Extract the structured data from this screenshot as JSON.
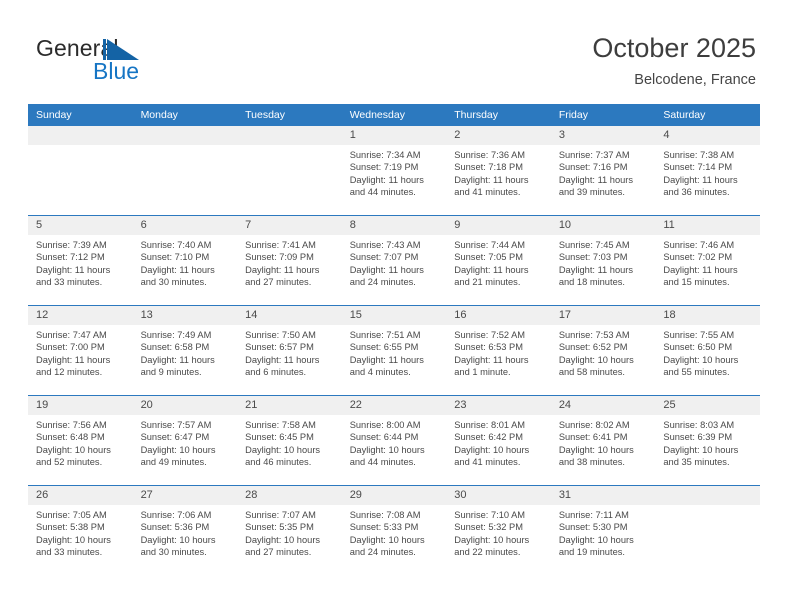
{
  "brand": {
    "name_top": "General",
    "name_bottom": "Blue",
    "accent_color": "#1675c4"
  },
  "header": {
    "title": "October 2025",
    "subtitle": "Belcodene, France"
  },
  "theme": {
    "header_row_bg": "#2c79bf",
    "day_number_bg": "#f0f0f0",
    "text_color": "#494949"
  },
  "weekdays": [
    "Sunday",
    "Monday",
    "Tuesday",
    "Wednesday",
    "Thursday",
    "Friday",
    "Saturday"
  ],
  "weeks": [
    [
      {
        "day": "",
        "sunrise": "",
        "sunset": "",
        "daylight_line1": "",
        "daylight_line2": ""
      },
      {
        "day": "",
        "sunrise": "",
        "sunset": "",
        "daylight_line1": "",
        "daylight_line2": ""
      },
      {
        "day": "",
        "sunrise": "",
        "sunset": "",
        "daylight_line1": "",
        "daylight_line2": ""
      },
      {
        "day": "1",
        "sunrise": "Sunrise: 7:34 AM",
        "sunset": "Sunset: 7:19 PM",
        "daylight_line1": "Daylight: 11 hours",
        "daylight_line2": "and 44 minutes."
      },
      {
        "day": "2",
        "sunrise": "Sunrise: 7:36 AM",
        "sunset": "Sunset: 7:18 PM",
        "daylight_line1": "Daylight: 11 hours",
        "daylight_line2": "and 41 minutes."
      },
      {
        "day": "3",
        "sunrise": "Sunrise: 7:37 AM",
        "sunset": "Sunset: 7:16 PM",
        "daylight_line1": "Daylight: 11 hours",
        "daylight_line2": "and 39 minutes."
      },
      {
        "day": "4",
        "sunrise": "Sunrise: 7:38 AM",
        "sunset": "Sunset: 7:14 PM",
        "daylight_line1": "Daylight: 11 hours",
        "daylight_line2": "and 36 minutes."
      }
    ],
    [
      {
        "day": "5",
        "sunrise": "Sunrise: 7:39 AM",
        "sunset": "Sunset: 7:12 PM",
        "daylight_line1": "Daylight: 11 hours",
        "daylight_line2": "and 33 minutes."
      },
      {
        "day": "6",
        "sunrise": "Sunrise: 7:40 AM",
        "sunset": "Sunset: 7:10 PM",
        "daylight_line1": "Daylight: 11 hours",
        "daylight_line2": "and 30 minutes."
      },
      {
        "day": "7",
        "sunrise": "Sunrise: 7:41 AM",
        "sunset": "Sunset: 7:09 PM",
        "daylight_line1": "Daylight: 11 hours",
        "daylight_line2": "and 27 minutes."
      },
      {
        "day": "8",
        "sunrise": "Sunrise: 7:43 AM",
        "sunset": "Sunset: 7:07 PM",
        "daylight_line1": "Daylight: 11 hours",
        "daylight_line2": "and 24 minutes."
      },
      {
        "day": "9",
        "sunrise": "Sunrise: 7:44 AM",
        "sunset": "Sunset: 7:05 PM",
        "daylight_line1": "Daylight: 11 hours",
        "daylight_line2": "and 21 minutes."
      },
      {
        "day": "10",
        "sunrise": "Sunrise: 7:45 AM",
        "sunset": "Sunset: 7:03 PM",
        "daylight_line1": "Daylight: 11 hours",
        "daylight_line2": "and 18 minutes."
      },
      {
        "day": "11",
        "sunrise": "Sunrise: 7:46 AM",
        "sunset": "Sunset: 7:02 PM",
        "daylight_line1": "Daylight: 11 hours",
        "daylight_line2": "and 15 minutes."
      }
    ],
    [
      {
        "day": "12",
        "sunrise": "Sunrise: 7:47 AM",
        "sunset": "Sunset: 7:00 PM",
        "daylight_line1": "Daylight: 11 hours",
        "daylight_line2": "and 12 minutes."
      },
      {
        "day": "13",
        "sunrise": "Sunrise: 7:49 AM",
        "sunset": "Sunset: 6:58 PM",
        "daylight_line1": "Daylight: 11 hours",
        "daylight_line2": "and 9 minutes."
      },
      {
        "day": "14",
        "sunrise": "Sunrise: 7:50 AM",
        "sunset": "Sunset: 6:57 PM",
        "daylight_line1": "Daylight: 11 hours",
        "daylight_line2": "and 6 minutes."
      },
      {
        "day": "15",
        "sunrise": "Sunrise: 7:51 AM",
        "sunset": "Sunset: 6:55 PM",
        "daylight_line1": "Daylight: 11 hours",
        "daylight_line2": "and 4 minutes."
      },
      {
        "day": "16",
        "sunrise": "Sunrise: 7:52 AM",
        "sunset": "Sunset: 6:53 PM",
        "daylight_line1": "Daylight: 11 hours",
        "daylight_line2": "and 1 minute."
      },
      {
        "day": "17",
        "sunrise": "Sunrise: 7:53 AM",
        "sunset": "Sunset: 6:52 PM",
        "daylight_line1": "Daylight: 10 hours",
        "daylight_line2": "and 58 minutes."
      },
      {
        "day": "18",
        "sunrise": "Sunrise: 7:55 AM",
        "sunset": "Sunset: 6:50 PM",
        "daylight_line1": "Daylight: 10 hours",
        "daylight_line2": "and 55 minutes."
      }
    ],
    [
      {
        "day": "19",
        "sunrise": "Sunrise: 7:56 AM",
        "sunset": "Sunset: 6:48 PM",
        "daylight_line1": "Daylight: 10 hours",
        "daylight_line2": "and 52 minutes."
      },
      {
        "day": "20",
        "sunrise": "Sunrise: 7:57 AM",
        "sunset": "Sunset: 6:47 PM",
        "daylight_line1": "Daylight: 10 hours",
        "daylight_line2": "and 49 minutes."
      },
      {
        "day": "21",
        "sunrise": "Sunrise: 7:58 AM",
        "sunset": "Sunset: 6:45 PM",
        "daylight_line1": "Daylight: 10 hours",
        "daylight_line2": "and 46 minutes."
      },
      {
        "day": "22",
        "sunrise": "Sunrise: 8:00 AM",
        "sunset": "Sunset: 6:44 PM",
        "daylight_line1": "Daylight: 10 hours",
        "daylight_line2": "and 44 minutes."
      },
      {
        "day": "23",
        "sunrise": "Sunrise: 8:01 AM",
        "sunset": "Sunset: 6:42 PM",
        "daylight_line1": "Daylight: 10 hours",
        "daylight_line2": "and 41 minutes."
      },
      {
        "day": "24",
        "sunrise": "Sunrise: 8:02 AM",
        "sunset": "Sunset: 6:41 PM",
        "daylight_line1": "Daylight: 10 hours",
        "daylight_line2": "and 38 minutes."
      },
      {
        "day": "25",
        "sunrise": "Sunrise: 8:03 AM",
        "sunset": "Sunset: 6:39 PM",
        "daylight_line1": "Daylight: 10 hours",
        "daylight_line2": "and 35 minutes."
      }
    ],
    [
      {
        "day": "26",
        "sunrise": "Sunrise: 7:05 AM",
        "sunset": "Sunset: 5:38 PM",
        "daylight_line1": "Daylight: 10 hours",
        "daylight_line2": "and 33 minutes."
      },
      {
        "day": "27",
        "sunrise": "Sunrise: 7:06 AM",
        "sunset": "Sunset: 5:36 PM",
        "daylight_line1": "Daylight: 10 hours",
        "daylight_line2": "and 30 minutes."
      },
      {
        "day": "28",
        "sunrise": "Sunrise: 7:07 AM",
        "sunset": "Sunset: 5:35 PM",
        "daylight_line1": "Daylight: 10 hours",
        "daylight_line2": "and 27 minutes."
      },
      {
        "day": "29",
        "sunrise": "Sunrise: 7:08 AM",
        "sunset": "Sunset: 5:33 PM",
        "daylight_line1": "Daylight: 10 hours",
        "daylight_line2": "and 24 minutes."
      },
      {
        "day": "30",
        "sunrise": "Sunrise: 7:10 AM",
        "sunset": "Sunset: 5:32 PM",
        "daylight_line1": "Daylight: 10 hours",
        "daylight_line2": "and 22 minutes."
      },
      {
        "day": "31",
        "sunrise": "Sunrise: 7:11 AM",
        "sunset": "Sunset: 5:30 PM",
        "daylight_line1": "Daylight: 10 hours",
        "daylight_line2": "and 19 minutes."
      },
      {
        "day": "",
        "sunrise": "",
        "sunset": "",
        "daylight_line1": "",
        "daylight_line2": ""
      }
    ]
  ]
}
